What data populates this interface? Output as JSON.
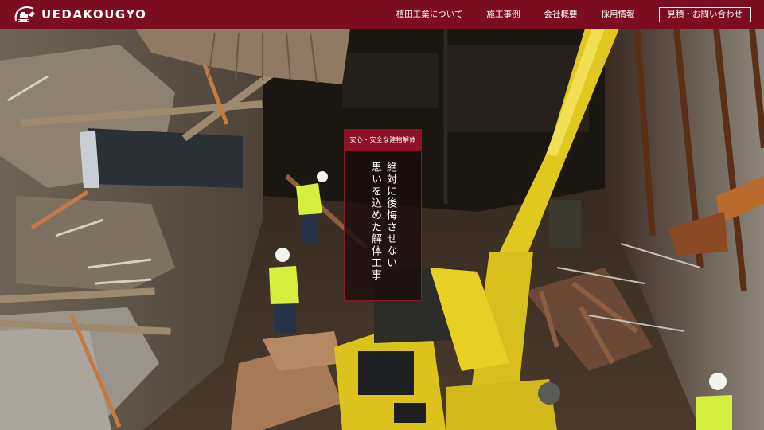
{
  "brand": {
    "name": "UEDAKOUGYO"
  },
  "nav": {
    "items": [
      {
        "label": "植田工業について"
      },
      {
        "label": "施工事例"
      },
      {
        "label": "会社概要"
      },
      {
        "label": "採用情報"
      }
    ],
    "cta_label": "見積・お問い合わせ"
  },
  "hero": {
    "tag": "安心・安全な建物解体",
    "headline_lines": [
      "絶対に後悔させない",
      "思いを込めた解体工事"
    ]
  },
  "colors": {
    "brand_red": "#7c0d21",
    "tag_red": "#8f1128",
    "excavator_yellow": "#e5cf22",
    "vest_yellow": "#d9f04a"
  },
  "icons": {
    "logo": "excavator-logo-icon"
  }
}
